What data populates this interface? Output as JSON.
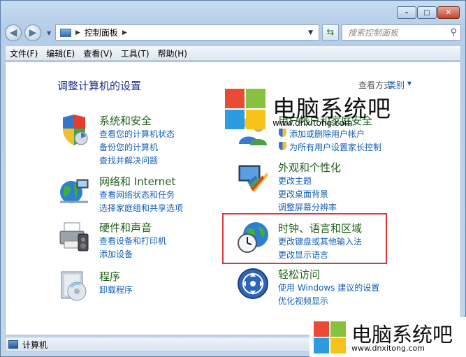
{
  "address": {
    "path": "控制面板"
  },
  "search": {
    "placeholder": "搜索控制面板"
  },
  "menu": [
    "文件(F)",
    "编辑(E)",
    "查看(V)",
    "工具(T)",
    "帮助(H)"
  ],
  "page_title": "调整计算机的设置",
  "view_by": {
    "label": "查看方式:",
    "value": "类别"
  },
  "categories": [
    {
      "title": "系统和安全",
      "links": [
        "查看您的计算机状态",
        "备份您的计算机",
        "查找并解决问题"
      ]
    },
    {
      "title": "网络和 Internet",
      "links": [
        "查看网络状态和任务",
        "选择家庭组和共享选项"
      ]
    },
    {
      "title": "硬件和声音",
      "links": [
        "查看设备和打印机",
        "添加设备"
      ]
    },
    {
      "title": "程序",
      "links": [
        "卸载程序"
      ]
    },
    {
      "title": "用户帐户和家庭安全",
      "links": [
        "添加或删除用户帐户",
        "为所有用户设置家长控制"
      ]
    },
    {
      "title": "外观和个性化",
      "links": [
        "更改主题",
        "更改桌面背景",
        "调整屏幕分辨率"
      ]
    },
    {
      "title": "时钟、语言和区域",
      "links": [
        "更改键盘或其他输入法",
        "更改显示语言"
      ]
    },
    {
      "title": "轻松访问",
      "links": [
        "使用 Windows 建议的设置",
        "优化视频显示"
      ]
    }
  ],
  "status": {
    "text": "计算机"
  },
  "watermark": {
    "text": "电脑系统吧",
    "url": "www.dnxitong.com"
  },
  "colors": {
    "title_blue": "#1e3287",
    "category_green": "#1e5f1a",
    "link_blue": "#1560b6",
    "highlight_red": "#d9383a"
  }
}
